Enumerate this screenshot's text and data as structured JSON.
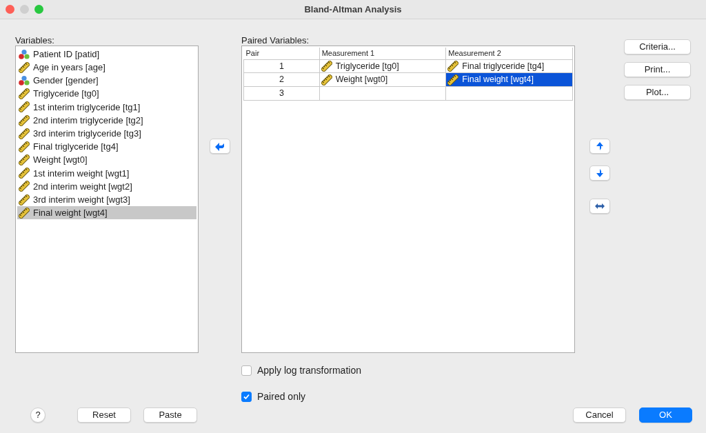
{
  "window": {
    "title": "Bland-Altman Analysis"
  },
  "variables": {
    "label": "Variables:",
    "items": [
      {
        "label": "Patient ID [patid]",
        "kind": "nominal",
        "selected": false
      },
      {
        "label": "Age in years [age]",
        "kind": "scale",
        "selected": false
      },
      {
        "label": "Gender [gender]",
        "kind": "nominal",
        "selected": false
      },
      {
        "label": "Triglyceride [tg0]",
        "kind": "scale",
        "selected": false
      },
      {
        "label": "1st interim triglyceride [tg1]",
        "kind": "scale",
        "selected": false
      },
      {
        "label": "2nd interim triglyceride [tg2]",
        "kind": "scale",
        "selected": false
      },
      {
        "label": "3rd interim triglyceride [tg3]",
        "kind": "scale",
        "selected": false
      },
      {
        "label": "Final triglyceride [tg4]",
        "kind": "scale",
        "selected": false
      },
      {
        "label": "Weight [wgt0]",
        "kind": "scale",
        "selected": false
      },
      {
        "label": "1st interim weight [wgt1]",
        "kind": "scale",
        "selected": false
      },
      {
        "label": "2nd interim weight [wgt2]",
        "kind": "scale",
        "selected": false
      },
      {
        "label": "3rd interim weight [wgt3]",
        "kind": "scale",
        "selected": false
      },
      {
        "label": "Final weight [wgt4]",
        "kind": "scale",
        "selected": true
      }
    ]
  },
  "paired": {
    "label": "Paired Variables:",
    "columns": [
      "Pair",
      "Measurement 1",
      "Measurement 2"
    ],
    "rows": [
      {
        "cells": [
          {
            "label": "1",
            "kind": "number",
            "selected": false
          },
          {
            "label": "Triglyceride [tg0]",
            "kind": "scale",
            "selected": false
          },
          {
            "label": "Final triglyceride [tg4]",
            "kind": "scale",
            "selected": false
          }
        ]
      },
      {
        "cells": [
          {
            "label": "2",
            "kind": "number",
            "selected": false
          },
          {
            "label": "Weight [wgt0]",
            "kind": "scale",
            "selected": false
          },
          {
            "label": "Final weight [wgt4]",
            "kind": "scale",
            "selected": true
          }
        ]
      },
      {
        "cells": [
          {
            "label": "3",
            "kind": "number",
            "selected": false
          },
          {
            "kind": "empty",
            "selected": false
          },
          {
            "kind": "empty",
            "selected": false
          }
        ]
      }
    ]
  },
  "side_buttons": [
    "Criteria...",
    "Print...",
    "Plot..."
  ],
  "options": [
    {
      "label": "Apply log transformation",
      "checked": false
    },
    {
      "label": "Paired only",
      "checked": true
    }
  ],
  "footer": {
    "help": "?",
    "left_buttons": [
      "Reset",
      "Paste"
    ],
    "cancel": "Cancel",
    "ok": "OK"
  }
}
